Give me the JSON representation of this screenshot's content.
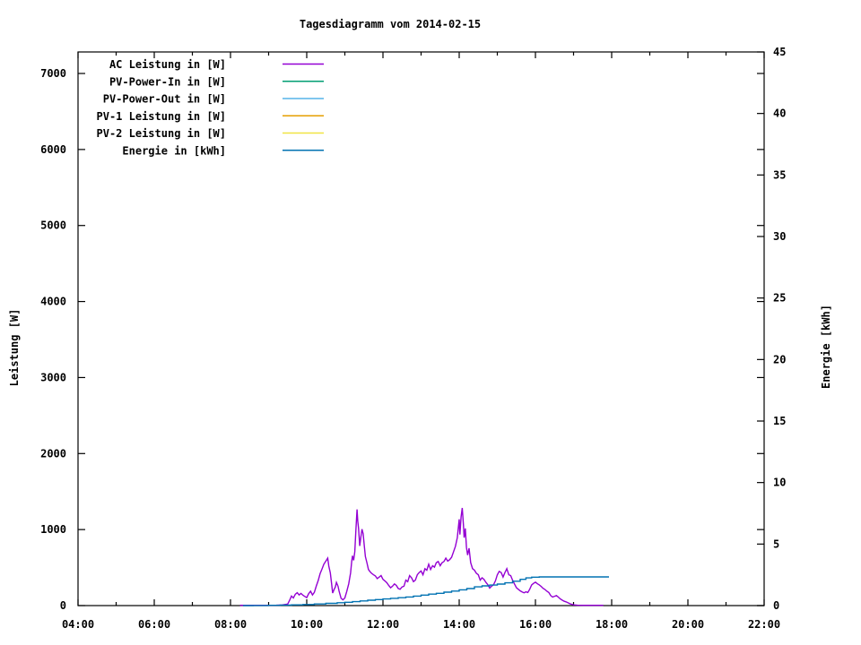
{
  "chart_data": {
    "type": "line",
    "title": "Tagesdiagramm vom 2014-02-15",
    "ylabel": "Leistung [W]",
    "y2label": "Energie [kWh]",
    "background_color": "#ffffff",
    "axis_color": "#000000",
    "grid": false,
    "legend_position": "top-left-inside",
    "x_axis": {
      "start_hour": 4,
      "end_hour": 22,
      "major_tick_labels": [
        "04:00",
        "06:00",
        "08:00",
        "10:00",
        "12:00",
        "14:00",
        "16:00",
        "18:00",
        "20:00",
        "22:00"
      ],
      "major_tick_every_hours": 2,
      "minor_tick_every_hours": 1
    },
    "y_axis": {
      "min": 0,
      "max": 7283,
      "tick_labels": [
        "0",
        "1000",
        "2000",
        "3000",
        "4000",
        "5000",
        "6000",
        "7000"
      ],
      "tick_step": 1000
    },
    "y2_axis": {
      "min": 0,
      "max": 45,
      "tick_labels": [
        "0",
        "5",
        "10",
        "15",
        "20",
        "25",
        "30",
        "35",
        "40",
        "45"
      ],
      "tick_step": 5
    },
    "series": [
      {
        "name": "AC Leistung in [W]",
        "color": "#9400D3",
        "axis": "y",
        "style": "line",
        "points": [
          [
            8.25,
            3
          ],
          [
            8.4,
            3
          ],
          [
            8.6,
            3
          ],
          [
            8.8,
            3
          ],
          [
            9.0,
            4
          ],
          [
            9.2,
            5
          ],
          [
            9.35,
            8
          ],
          [
            9.5,
            20
          ],
          [
            9.55,
            70
          ],
          [
            9.6,
            125
          ],
          [
            9.65,
            100
          ],
          [
            9.7,
            150
          ],
          [
            9.75,
            170
          ],
          [
            9.8,
            140
          ],
          [
            9.85,
            160
          ],
          [
            9.9,
            135
          ],
          [
            9.95,
            120
          ],
          [
            10.0,
            105
          ],
          [
            10.05,
            155
          ],
          [
            10.1,
            190
          ],
          [
            10.15,
            140
          ],
          [
            10.2,
            175
          ],
          [
            10.25,
            255
          ],
          [
            10.3,
            330
          ],
          [
            10.35,
            420
          ],
          [
            10.4,
            480
          ],
          [
            10.45,
            545
          ],
          [
            10.5,
            585
          ],
          [
            10.55,
            625
          ],
          [
            10.58,
            520
          ],
          [
            10.62,
            430
          ],
          [
            10.65,
            300
          ],
          [
            10.68,
            165
          ],
          [
            10.72,
            215
          ],
          [
            10.75,
            245
          ],
          [
            10.78,
            305
          ],
          [
            10.82,
            255
          ],
          [
            10.85,
            190
          ],
          [
            10.9,
            95
          ],
          [
            10.95,
            75
          ],
          [
            11.0,
            100
          ],
          [
            11.05,
            185
          ],
          [
            11.1,
            285
          ],
          [
            11.15,
            430
          ],
          [
            11.18,
            575
          ],
          [
            11.2,
            655
          ],
          [
            11.23,
            595
          ],
          [
            11.26,
            710
          ],
          [
            11.29,
            990
          ],
          [
            11.32,
            1265
          ],
          [
            11.34,
            1110
          ],
          [
            11.36,
            1015
          ],
          [
            11.39,
            785
          ],
          [
            11.42,
            905
          ],
          [
            11.45,
            1005
          ],
          [
            11.48,
            945
          ],
          [
            11.51,
            785
          ],
          [
            11.54,
            645
          ],
          [
            11.58,
            565
          ],
          [
            11.62,
            475
          ],
          [
            11.66,
            445
          ],
          [
            11.7,
            425
          ],
          [
            11.75,
            405
          ],
          [
            11.8,
            390
          ],
          [
            11.85,
            355
          ],
          [
            11.9,
            375
          ],
          [
            11.95,
            395
          ],
          [
            12.0,
            345
          ],
          [
            12.05,
            325
          ],
          [
            12.1,
            300
          ],
          [
            12.15,
            265
          ],
          [
            12.2,
            235
          ],
          [
            12.25,
            255
          ],
          [
            12.3,
            285
          ],
          [
            12.35,
            265
          ],
          [
            12.4,
            225
          ],
          [
            12.45,
            215
          ],
          [
            12.5,
            245
          ],
          [
            12.55,
            255
          ],
          [
            12.6,
            335
          ],
          [
            12.65,
            315
          ],
          [
            12.7,
            395
          ],
          [
            12.75,
            365
          ],
          [
            12.8,
            315
          ],
          [
            12.85,
            335
          ],
          [
            12.9,
            405
          ],
          [
            12.95,
            435
          ],
          [
            13.0,
            455
          ],
          [
            13.05,
            405
          ],
          [
            13.1,
            485
          ],
          [
            13.15,
            465
          ],
          [
            13.2,
            545
          ],
          [
            13.25,
            475
          ],
          [
            13.3,
            525
          ],
          [
            13.35,
            505
          ],
          [
            13.4,
            565
          ],
          [
            13.45,
            580
          ],
          [
            13.5,
            525
          ],
          [
            13.55,
            565
          ],
          [
            13.6,
            580
          ],
          [
            13.65,
            625
          ],
          [
            13.7,
            585
          ],
          [
            13.75,
            605
          ],
          [
            13.8,
            635
          ],
          [
            13.85,
            705
          ],
          [
            13.9,
            780
          ],
          [
            13.95,
            895
          ],
          [
            14.0,
            1135
          ],
          [
            14.02,
            935
          ],
          [
            14.05,
            1165
          ],
          [
            14.08,
            1285
          ],
          [
            14.11,
            1065
          ],
          [
            14.13,
            895
          ],
          [
            14.16,
            1015
          ],
          [
            14.19,
            765
          ],
          [
            14.22,
            665
          ],
          [
            14.26,
            755
          ],
          [
            14.3,
            565
          ],
          [
            14.35,
            485
          ],
          [
            14.4,
            465
          ],
          [
            14.45,
            425
          ],
          [
            14.5,
            405
          ],
          [
            14.55,
            335
          ],
          [
            14.6,
            365
          ],
          [
            14.65,
            345
          ],
          [
            14.7,
            305
          ],
          [
            14.75,
            275
          ],
          [
            14.8,
            230
          ],
          [
            14.85,
            255
          ],
          [
            14.9,
            275
          ],
          [
            14.95,
            325
          ],
          [
            15.0,
            405
          ],
          [
            15.05,
            450
          ],
          [
            15.1,
            435
          ],
          [
            15.15,
            375
          ],
          [
            15.2,
            435
          ],
          [
            15.25,
            485
          ],
          [
            15.3,
            405
          ],
          [
            15.35,
            395
          ],
          [
            15.4,
            335
          ],
          [
            15.45,
            285
          ],
          [
            15.5,
            235
          ],
          [
            15.55,
            215
          ],
          [
            15.6,
            195
          ],
          [
            15.65,
            180
          ],
          [
            15.7,
            168
          ],
          [
            15.75,
            182
          ],
          [
            15.8,
            172
          ],
          [
            15.85,
            215
          ],
          [
            15.9,
            272
          ],
          [
            15.95,
            292
          ],
          [
            16.0,
            308
          ],
          [
            16.05,
            288
          ],
          [
            16.1,
            272
          ],
          [
            16.15,
            252
          ],
          [
            16.2,
            228
          ],
          [
            16.25,
            212
          ],
          [
            16.3,
            188
          ],
          [
            16.35,
            172
          ],
          [
            16.4,
            132
          ],
          [
            16.45,
            112
          ],
          [
            16.5,
            122
          ],
          [
            16.55,
            132
          ],
          [
            16.6,
            112
          ],
          [
            16.65,
            88
          ],
          [
            16.7,
            72
          ],
          [
            16.75,
            58
          ],
          [
            16.8,
            50
          ],
          [
            16.85,
            38
          ],
          [
            16.9,
            26
          ],
          [
            16.95,
            16
          ],
          [
            17.0,
            9
          ],
          [
            17.1,
            5
          ],
          [
            17.25,
            3
          ],
          [
            17.45,
            3
          ],
          [
            17.6,
            3
          ],
          [
            17.78,
            3
          ]
        ]
      },
      {
        "name": "PV-Power-In in [W]",
        "color": "#009E73",
        "axis": "y",
        "style": "line",
        "points": []
      },
      {
        "name": "PV-Power-Out in [W]",
        "color": "#56B4E9",
        "axis": "y",
        "style": "line",
        "points": []
      },
      {
        "name": "PV-1 Leistung in [W]",
        "color": "#E69F00",
        "axis": "y",
        "style": "line",
        "points": []
      },
      {
        "name": "PV-2 Leistung in [W]",
        "color": "#F0E442",
        "axis": "y",
        "style": "line",
        "points": []
      },
      {
        "name": "Energie in [kWh]",
        "color": "#0072B2",
        "axis": "y2",
        "style": "steps",
        "points": [
          [
            8.33,
            0
          ],
          [
            8.6,
            0.01
          ],
          [
            9.0,
            0.02
          ],
          [
            9.3,
            0.04
          ],
          [
            9.6,
            0.06
          ],
          [
            9.9,
            0.09
          ],
          [
            10.2,
            0.13
          ],
          [
            10.5,
            0.18
          ],
          [
            10.8,
            0.23
          ],
          [
            11.0,
            0.27
          ],
          [
            11.2,
            0.32
          ],
          [
            11.4,
            0.38
          ],
          [
            11.6,
            0.44
          ],
          [
            11.8,
            0.49
          ],
          [
            12.0,
            0.54
          ],
          [
            12.2,
            0.59
          ],
          [
            12.4,
            0.64
          ],
          [
            12.6,
            0.7
          ],
          [
            12.8,
            0.77
          ],
          [
            13.0,
            0.85
          ],
          [
            13.2,
            0.93
          ],
          [
            13.4,
            1.0
          ],
          [
            13.6,
            1.09
          ],
          [
            13.8,
            1.18
          ],
          [
            14.0,
            1.28
          ],
          [
            14.2,
            1.38
          ],
          [
            14.4,
            1.52
          ],
          [
            14.6,
            1.6
          ],
          [
            14.8,
            1.67
          ],
          [
            15.0,
            1.75
          ],
          [
            15.2,
            1.85
          ],
          [
            15.4,
            1.98
          ],
          [
            15.6,
            2.13
          ],
          [
            15.75,
            2.25
          ],
          [
            15.9,
            2.31
          ],
          [
            16.1,
            2.33
          ],
          [
            16.5,
            2.33
          ],
          [
            17.0,
            2.33
          ],
          [
            17.5,
            2.33
          ],
          [
            17.93,
            2.33
          ]
        ]
      }
    ]
  }
}
